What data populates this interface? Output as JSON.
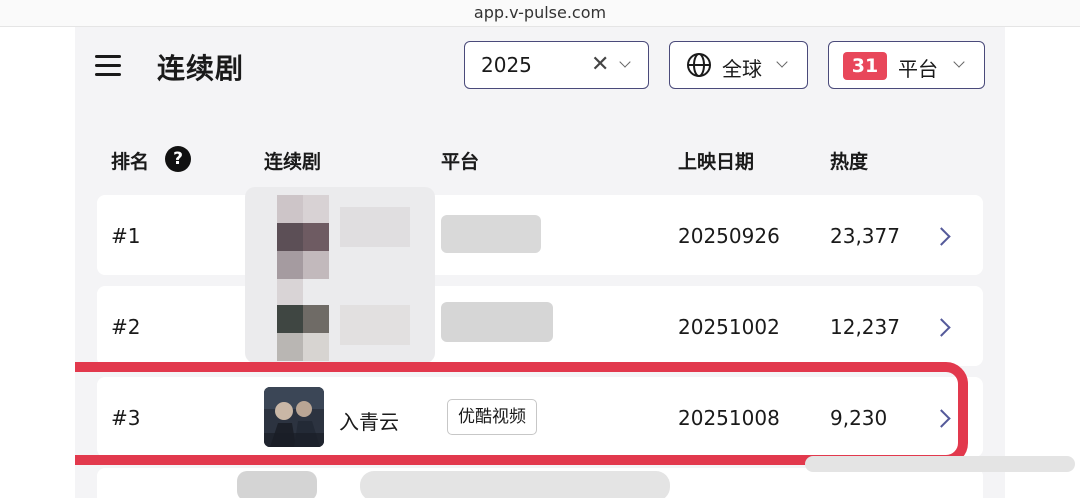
{
  "browser": {
    "url": "app.v-pulse.com"
  },
  "header": {
    "title": "连续剧",
    "year_filter": {
      "value": "2025"
    },
    "region_filter": {
      "value": "全球"
    },
    "platform_filter": {
      "count": "31",
      "label": "平台"
    }
  },
  "table": {
    "columns": [
      "排名",
      "连续剧",
      "平台",
      "上映日期",
      "热度"
    ],
    "rows": [
      {
        "rank": "#1",
        "title": "",
        "platform": "",
        "date": "20250926",
        "heat": "23,377"
      },
      {
        "rank": "#2",
        "title": "",
        "platform": "",
        "date": "20251002",
        "heat": "12,237"
      },
      {
        "rank": "#3",
        "title": "入青云",
        "platform": "优酷视频",
        "date": "20251008",
        "heat": "9,230"
      }
    ]
  },
  "colors": {
    "accent": "#e8475a",
    "highlight": "#e2394d",
    "border": "#4a4a7a"
  },
  "icons": [
    "menu-icon",
    "clear-icon",
    "globe-icon",
    "chevron-down-icon",
    "help-icon",
    "chevron-right-icon"
  ]
}
